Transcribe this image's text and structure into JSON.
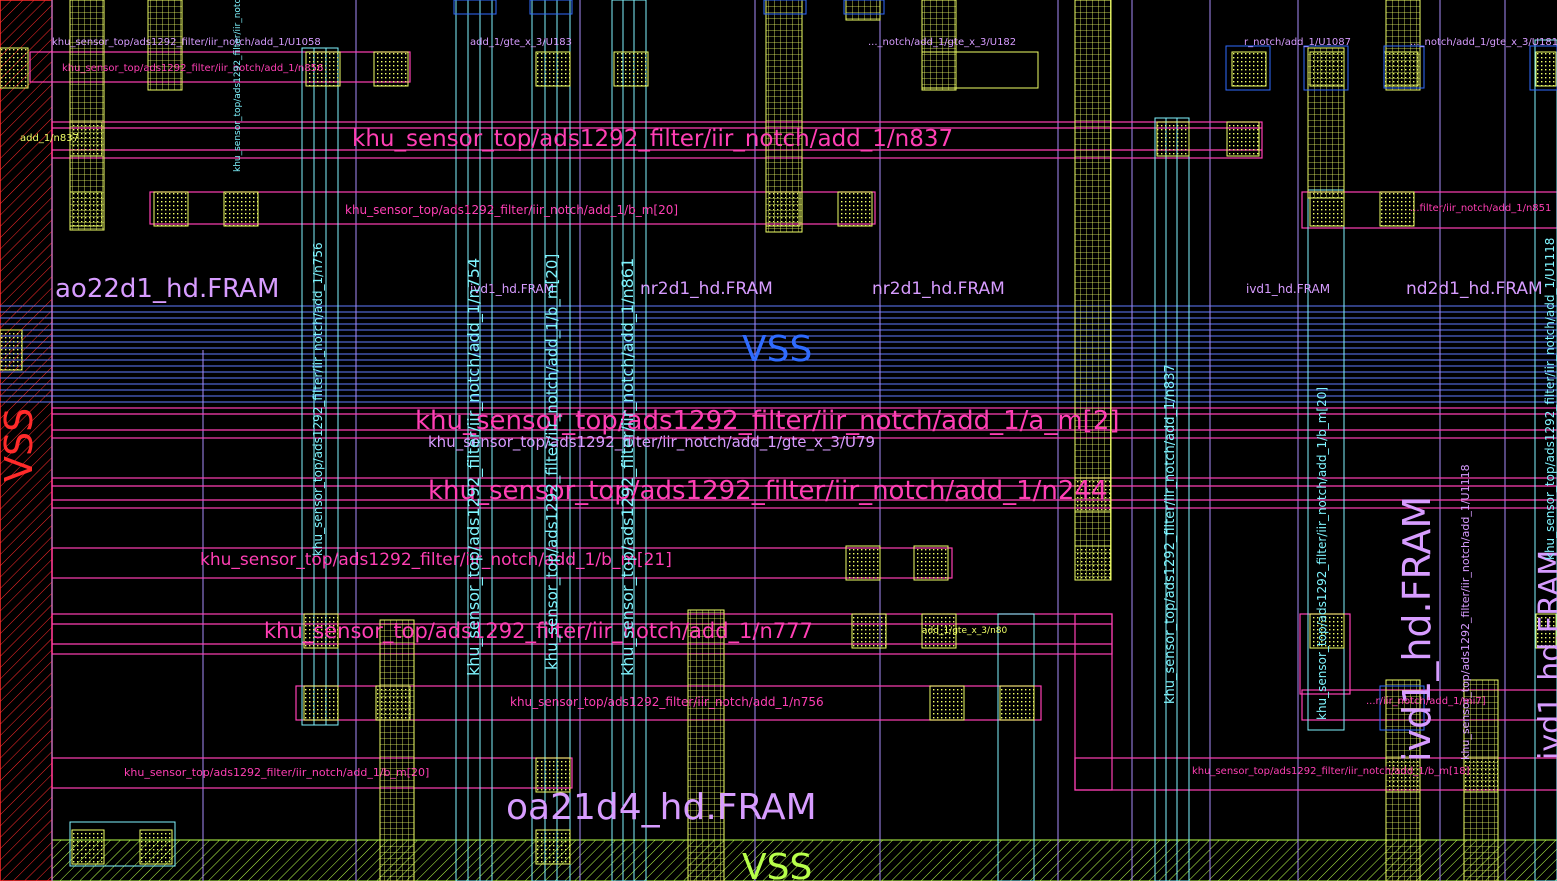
{
  "colors": {
    "background": "#000000",
    "metal1": "#ff3fb4",
    "metal2": "#5f7dff",
    "poly_cyan": "#7ff5ff",
    "cell_yellow": "#f0ff66",
    "vss_blue": "#2f6bff",
    "vss_red": "#ff2a2a",
    "vss_green": "#b8ff4a",
    "cell_label": "#d79cff"
  },
  "cell_labels": {
    "ao22d1": "ao22d1_hd.FRAM",
    "ivd1_small": "ivd1_hd.FRAM",
    "nr2d1_a": "nr2d1_hd.FRAM",
    "nr2d1_b": "nr2d1_hd.FRAM",
    "ivd1_mid": "ivd1_hd.FRAM",
    "nd2d1": "nd2d1_hd.FRAM",
    "oa21d4": "oa21d4_hd.FRAM",
    "ivd1_big": "ivd1_hd.FRAM",
    "ivd1_edge": "ivd1_hd.FRAM"
  },
  "vss_labels": {
    "center": "VSS",
    "left": "VSS",
    "bottom": "VSS"
  },
  "net_labels": {
    "n837": "khu_sensor_top/ads1292_filter/iir_notch/add_1/n837",
    "a_m2": "khu_sensor_top/ads1292_filter/iir_notch/add_1/a_m[2]",
    "u79": "khu_sensor_top/ads1292_filter/iir_notch/add_1/gte_x_3/U79",
    "n244": "khu_sensor_top/ads1292_filter/iir_notch/add_1/n244",
    "m21": "khu_sensor_top/ads1292_filter/iir_notch/add_1/b_m[21]",
    "n777": "khu_sensor_top/ads1292_filter/iir_notch/add_1/n777",
    "n756": "khu_sensor_top/ads1292_filter/iir_notch/add_1/n756",
    "m20_row": "khu_sensor_top/ads1292_filter/iir_notch/add_1/b_m[20]",
    "m20_top": "khu_sensor_top/ads1292_filter/iir_notch/add_1/b_m[20]",
    "u1058": "khu_sensor_top/ads1292_filter/iir_notch/add_1/U1058",
    "gte_u183": "add_1/gte_x_3/U183",
    "u182": "..._notch/add_1/gte_x_3/U182",
    "u1087": "r_notch/add_1/U1087",
    "u181": "..._notch/add_1/gte_x_3/U181",
    "n856": "khu_sensor_top/ads1292_filter/iir_notch/add_1/n856",
    "n837_small": "add_1/n837",
    "n851": "...filter/iir_notch/add_1/n851",
    "u1118": "khu_sensor_top/ads1292_filter/iir_notch/add_1/U1118",
    "gte_u80": "add_1/gte_x_3/n80",
    "mi7": "...r/iir_notch/add_1/mi7]",
    "m18": "khu_sensor_top/ads1292_filter/iir_notch/add_1/b_m[18]",
    "v_n756": "khu_sensor_top/ads1292_filter/iir_notch/add_1/n756",
    "v_n754": "khu_sensor_top/ads1292_filter/iir_notch/add_1/n754",
    "v_bm20": "khu_sensor_top/ads1292_filter/iir_notch/add_1/b_m[20]",
    "v_n861": "khu_sensor_top/ads1292_filter/iir_notch/add_1/n861",
    "v_n837": "khu_sensor_top/ads1292_filter/iir_notch/add_1/n837",
    "v_n756b": "khu_sensor_top/ads1292_filter/iir_notch/add_1/n756",
    "v_bm20b": "khu_sensor_top/ads1292_filter/iir_notch/add_1/b_m[20]",
    "v_u1118": "khu_sensor_top/ads1292_filter/iir_notch/add_1/U1118"
  }
}
